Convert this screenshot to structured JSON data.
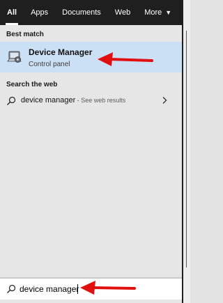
{
  "tabs": [
    {
      "label": "All",
      "active": true
    },
    {
      "label": "Apps"
    },
    {
      "label": "Documents"
    },
    {
      "label": "Web"
    },
    {
      "label": "More",
      "caret": "▼"
    }
  ],
  "best_match": {
    "heading": "Best match",
    "title": "Device Manager",
    "subtitle": "Control panel",
    "icon": "device-manager-icon"
  },
  "search_web": {
    "heading": "Search the web",
    "query": "device manager",
    "suffix": " - See web results",
    "icon": "search-icon"
  },
  "searchbox": {
    "value": "device manager"
  },
  "colors": {
    "tabbar": "#1f1f1f",
    "highlight": "#cce0f5",
    "annotation_arrow": "#e01010"
  }
}
